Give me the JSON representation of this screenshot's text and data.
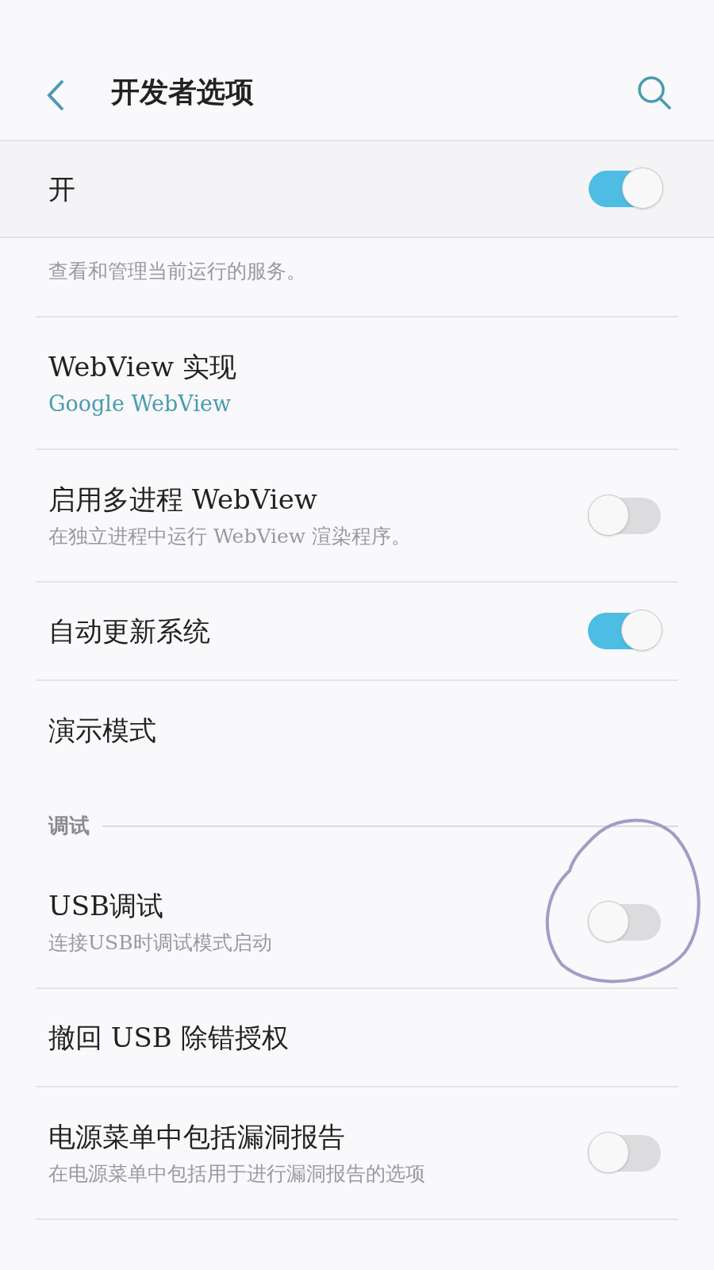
{
  "header": {
    "title": "开发者选项"
  },
  "master": {
    "label": "开",
    "on": true
  },
  "items": [
    {
      "kind": "plain",
      "subtitle": "查看和管理当前运行的服务。"
    },
    {
      "kind": "value",
      "title": "WebView 实现",
      "value": "Google WebView"
    },
    {
      "kind": "toggle",
      "title": "启用多进程 WebView",
      "subtitle": "在独立进程中运行 WebView 渲染程序。",
      "on": false
    },
    {
      "kind": "toggle",
      "title": "自动更新系统",
      "on": true
    },
    {
      "kind": "plain",
      "title": "演示模式"
    },
    {
      "kind": "section",
      "title": "调试"
    },
    {
      "kind": "toggle",
      "title": "USB调试",
      "subtitle": "连接USB时调试模式启动",
      "on": false,
      "annotated": true
    },
    {
      "kind": "plain",
      "title": "撤回 USB 除错授权"
    },
    {
      "kind": "toggle",
      "title": "电源菜单中包括漏洞报告",
      "subtitle": "在电源菜单中包括用于进行漏洞报告的选项",
      "on": false
    }
  ]
}
